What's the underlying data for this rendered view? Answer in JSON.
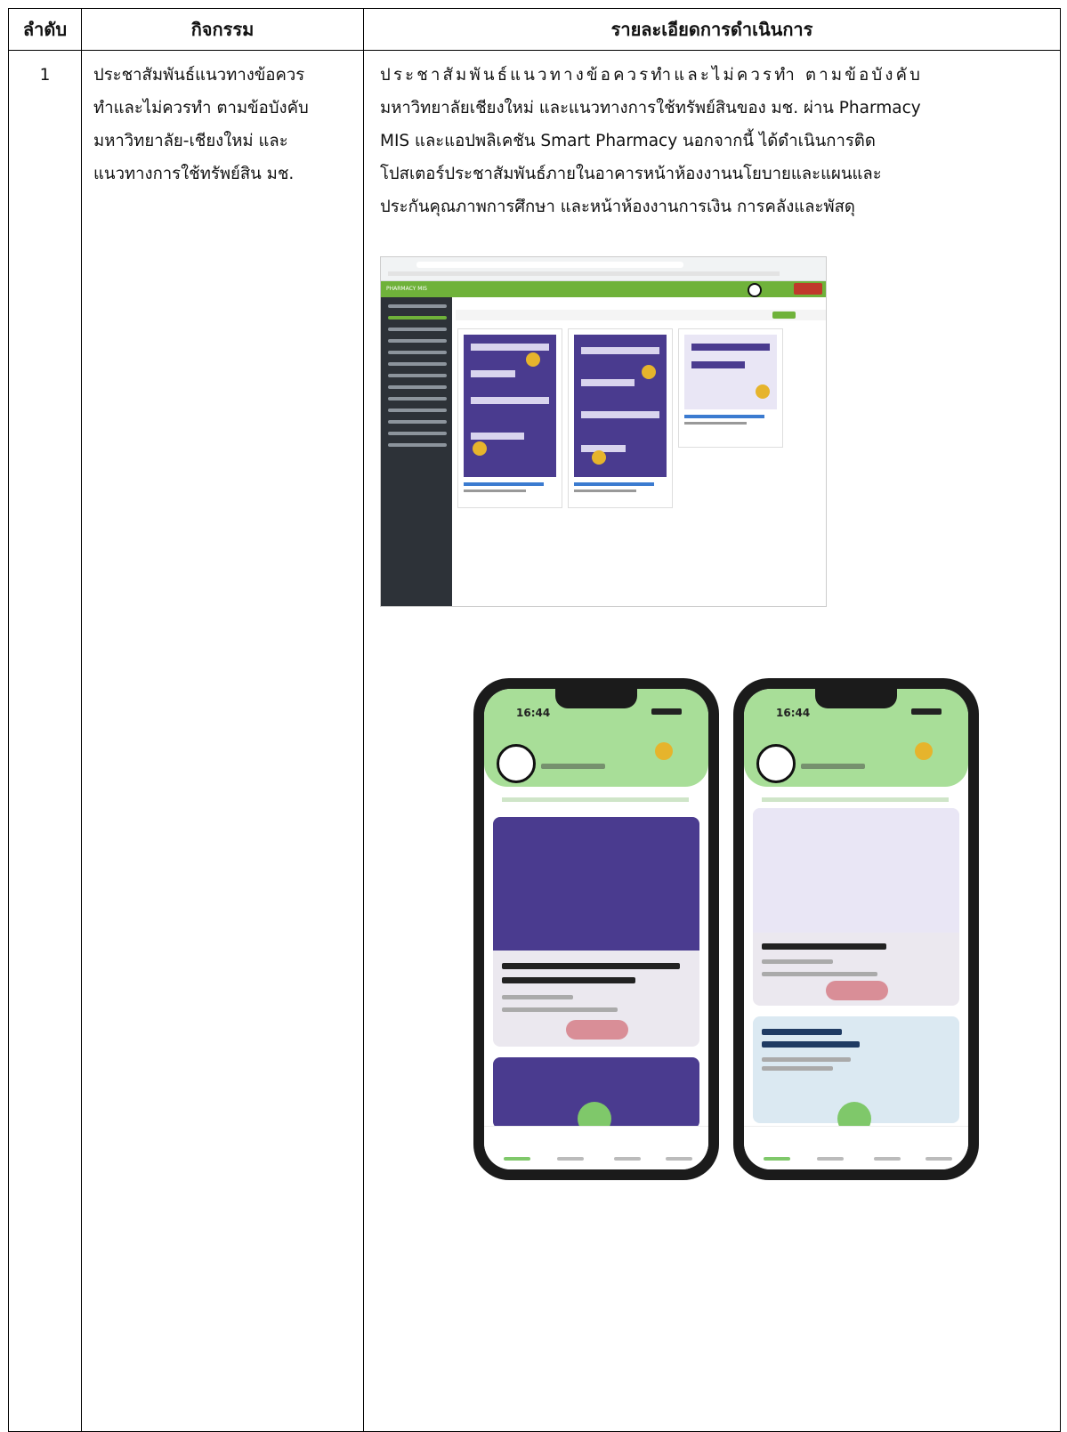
{
  "table": {
    "headers": [
      "ลำดับ",
      "กิจกรรม",
      "รายละเอียดการดำเนินการ"
    ],
    "row": {
      "number": "1",
      "activity_lines": [
        "ประชาสัมพันธ์แนวทางข้อควร",
        "ทำและไม่ควรทำ ตามข้อบังคับ",
        "มหาวิทยาลัย-เชียงใหม่ และ",
        "แนวทางการใช้ทรัพย์สิน มช."
      ],
      "detail_lines": [
        "ประชาสัมพันธ์แนวทางข้อควรทำและไม่ควรทำ ตามข้อบังคับ",
        "มหาวิทยาลัยเชียงใหม่ และแนวทางการใช้ทรัพย์สินของ มช. ผ่าน Pharmacy",
        "MIS และแอปพลิเคชัน Smart Pharmacy นอกจากนี้ ได้ดำเนินการติด",
        "โปสเตอร์ประชาสัมพันธ์ภายในอาคารหน้าห้องงานนโยบายและแผนและ",
        "ประกันคุณภาพการศึกษา และหน้าห้องงานการเงิน การคลังและพัสดุ"
      ]
    }
  },
  "desktop_screenshot": {
    "app_title": "PHARMACY MIS",
    "accent_color": "#6fb23a",
    "tile_colors": [
      "#e0306a",
      "#3b7bd0",
      "#8e6fc4",
      "#b9a3d8",
      "#f7b96a",
      "#d8336b",
      "#2d8fd0",
      "#5aa35a",
      "#8e6fc4",
      "#2d9fd8",
      "#d8336b",
      "#f0962b",
      "#c9433a"
    ]
  },
  "phone_screenshots": [
    {
      "time": "16:44"
    },
    {
      "time": "16:44"
    }
  ]
}
